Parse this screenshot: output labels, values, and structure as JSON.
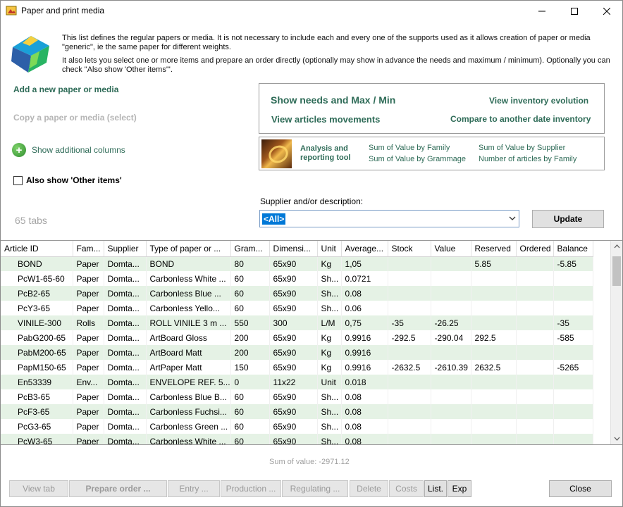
{
  "window": {
    "title": "Paper and print media"
  },
  "intro": {
    "line1": "This list defines the regular papers or media. It is not necessary to include each and every one of the supports used as it allows creation of paper or media \"generic\", ie the same paper for different weights.",
    "line2": "It also lets you select one or more items and prepare an order directly (optionally may show in advance the needs and maximum / minimum). Optionally you can check \"Also show 'Other items'\"."
  },
  "left": {
    "add_link": "Add a new paper or media",
    "copy_link": "Copy a paper or media (select)",
    "show_columns": "Show additional columns",
    "also_show": "Also show 'Other items'",
    "tabs_count": "65 tabs"
  },
  "actions": {
    "needs": "Show needs and Max / Min",
    "inventory_evolution": "View inventory evolution",
    "movements": "View articles movements",
    "compare": "Compare to another date inventory"
  },
  "analysis": {
    "title": "Analysis and reporting tool",
    "links": [
      "Sum of Value by Family",
      "Sum of Value by Grammage",
      "Sum of Value by Supplier",
      "Number of articles by Family"
    ]
  },
  "filter": {
    "label": "Supplier and/or description:",
    "value": "<All>",
    "update_button": "Update"
  },
  "table": {
    "columns": [
      "Article ID",
      "Fam...",
      "Supplier",
      "Type of paper or ...",
      "Gram...",
      "Dimensi...",
      "Unit",
      "Average...",
      "Stock",
      "Value",
      "Reserved",
      "Ordered",
      "Balance"
    ],
    "rows": [
      [
        "BOND",
        "Paper",
        "Domta...",
        "BOND",
        "80",
        "65x90",
        "Kg",
        "1,05",
        "",
        "",
        "5.85",
        "",
        "-5.85"
      ],
      [
        "PcW1-65-60",
        "Paper",
        "Domta...",
        "Carbonless White ...",
        "60",
        "65x90",
        "Sh...",
        "0.0721",
        "",
        "",
        "",
        "",
        ""
      ],
      [
        "PcB2-65",
        "Paper",
        "Domta...",
        "Carbonless Blue ...",
        "60",
        "65x90",
        "Sh...",
        "0.08",
        "",
        "",
        "",
        "",
        ""
      ],
      [
        "PcY3-65",
        "Paper",
        "Domta...",
        "Carbonless Yello...",
        "60",
        "65x90",
        "Sh...",
        "0.06",
        "",
        "",
        "",
        "",
        ""
      ],
      [
        "VINILE-300",
        "Rolls",
        "Domta...",
        "ROLL VINILE 3 m ...",
        "550",
        "300",
        "L/M",
        "0,75",
        "-35",
        "-26.25",
        "",
        "",
        "-35"
      ],
      [
        "PabG200-65",
        "Paper",
        "Domta...",
        "ArtBoard Gloss",
        "200",
        "65x90",
        "Kg",
        "0.9916",
        "-292.5",
        "-290.04",
        "292.5",
        "",
        "-585"
      ],
      [
        "PabM200-65",
        "Paper",
        "Domta...",
        "ArtBoard Matt",
        "200",
        "65x90",
        "Kg",
        "0.9916",
        "",
        "",
        "",
        "",
        ""
      ],
      [
        "PapM150-65",
        "Paper",
        "Domta...",
        "ArtPaper Matt",
        "150",
        "65x90",
        "Kg",
        "0.9916",
        "-2632.5",
        "-2610.39",
        "2632.5",
        "",
        "-5265"
      ],
      [
        "En53339",
        "Env...",
        "Domta...",
        "ENVELOPE REF. 5...",
        "0",
        "11x22",
        "Unit",
        "0.018",
        "",
        "",
        "",
        "",
        ""
      ],
      [
        "PcB3-65",
        "Paper",
        "Domta...",
        "Carbonless Blue B...",
        "60",
        "65x90",
        "Sh...",
        "0.08",
        "",
        "",
        "",
        "",
        ""
      ],
      [
        "PcF3-65",
        "Paper",
        "Domta...",
        "Carbonless Fuchsi...",
        "60",
        "65x90",
        "Sh...",
        "0.08",
        "",
        "",
        "",
        "",
        ""
      ],
      [
        "PcG3-65",
        "Paper",
        "Domta...",
        "Carbonless Green ...",
        "60",
        "65x90",
        "Sh...",
        "0.08",
        "",
        "",
        "",
        "",
        ""
      ],
      [
        "PcW3-65",
        "Paper",
        "Domta...",
        "Carbonless White ...",
        "60",
        "65x90",
        "Sh...",
        "0.08",
        "",
        "",
        "",
        "",
        ""
      ]
    ]
  },
  "footer": {
    "sum_value": "Sum of value: -2971.12",
    "buttons": [
      "View tab",
      "Prepare order ...",
      "Entry ...",
      "Production ...",
      "Regulating ...",
      "Delete",
      "Costs",
      "List.",
      "Exp"
    ],
    "close": "Close"
  },
  "colors": {
    "link_green": "#2e6b57",
    "row_stripe": "#e5f2e5",
    "selection": "#0078d7"
  }
}
